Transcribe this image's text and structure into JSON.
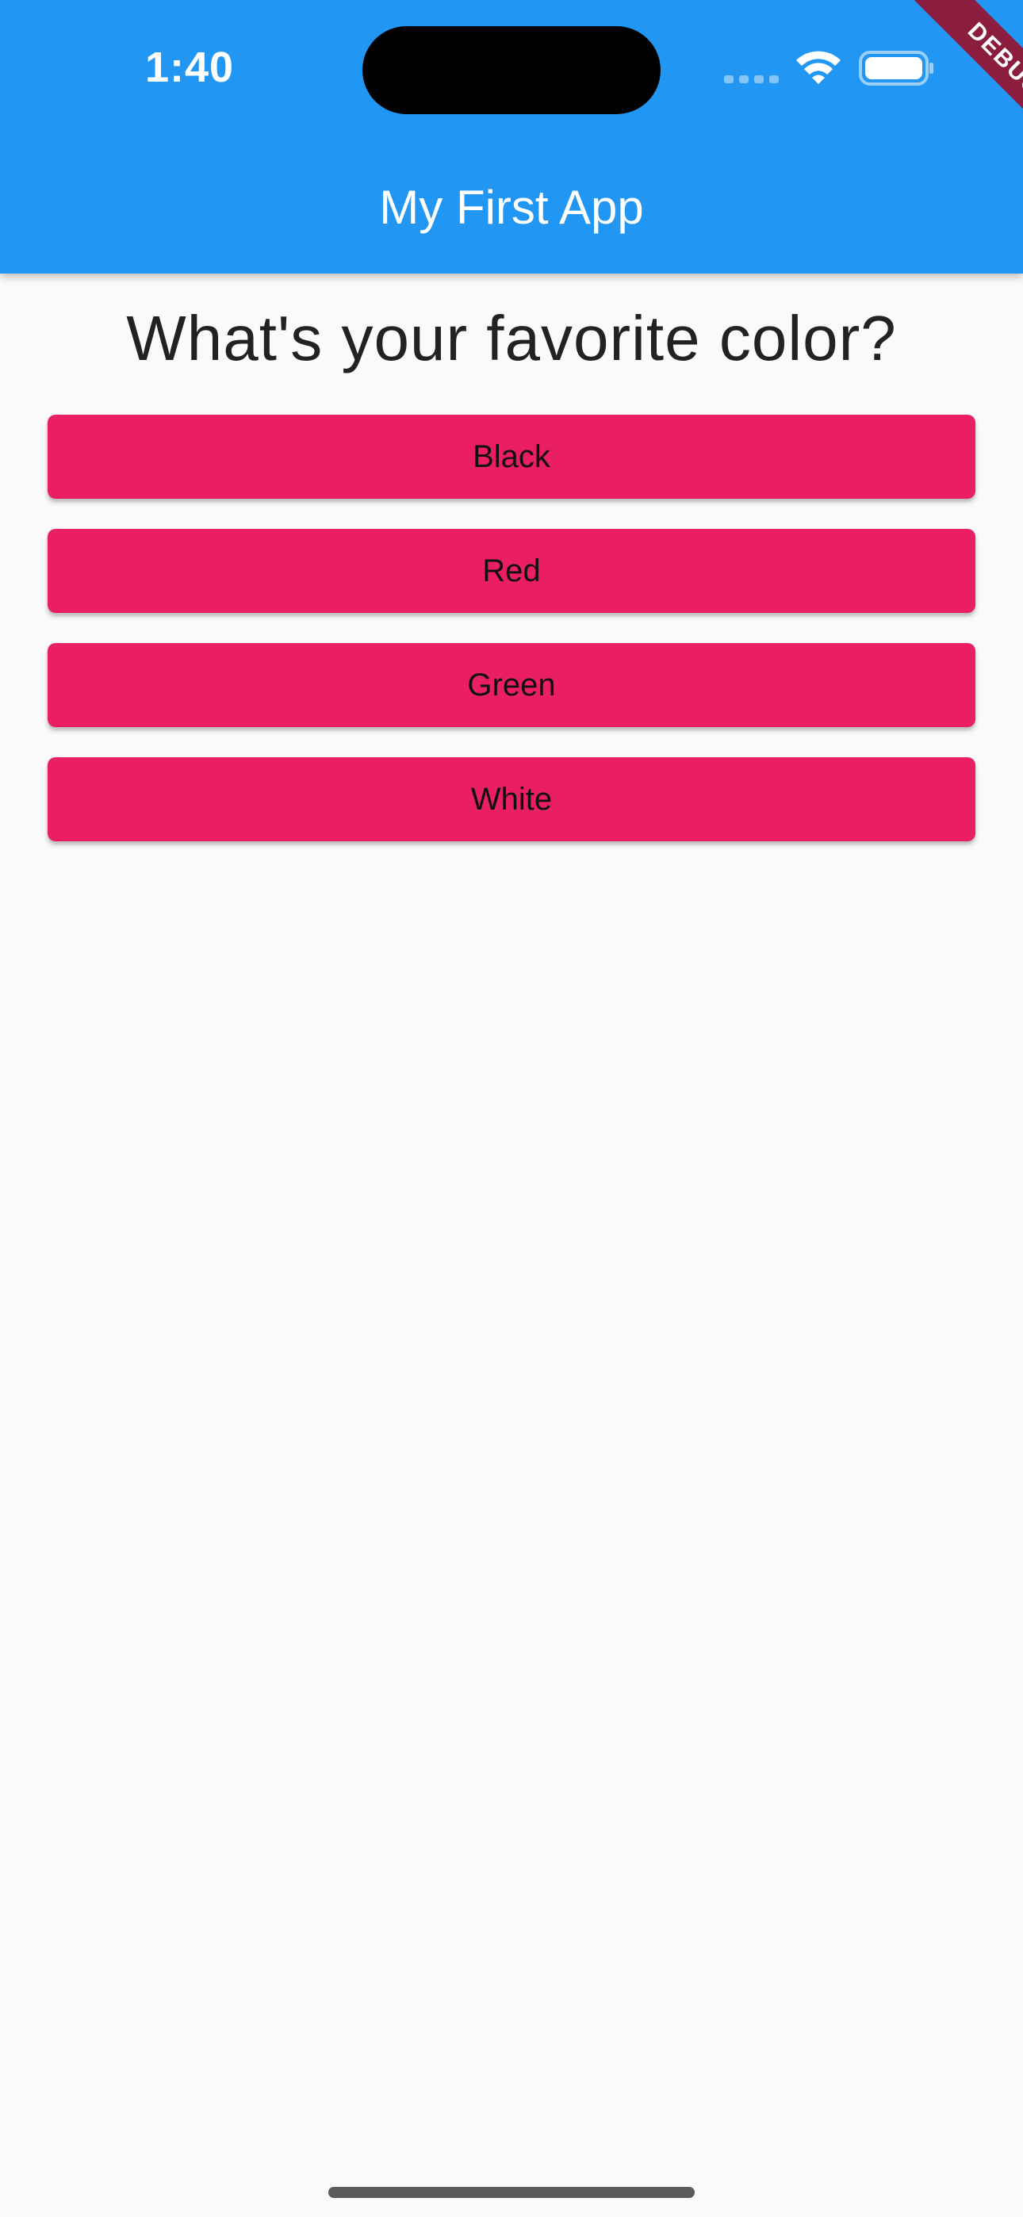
{
  "status_bar": {
    "time": "1:40"
  },
  "app_bar": {
    "title": "My First App"
  },
  "debug_banner": {
    "label": "DEBUG"
  },
  "quiz": {
    "question": "What's your favorite color?",
    "answers": [
      {
        "label": "Black"
      },
      {
        "label": "Red"
      },
      {
        "label": "Green"
      },
      {
        "label": "White"
      }
    ]
  },
  "icons": {
    "signal": "cellular-signal-icon",
    "wifi": "wifi-icon",
    "battery": "battery-icon"
  },
  "colors": {
    "app_bar": "#2196f3",
    "answer_button": "#e91e63",
    "debug_banner": "#8b1d3e",
    "background": "#fafafa"
  }
}
